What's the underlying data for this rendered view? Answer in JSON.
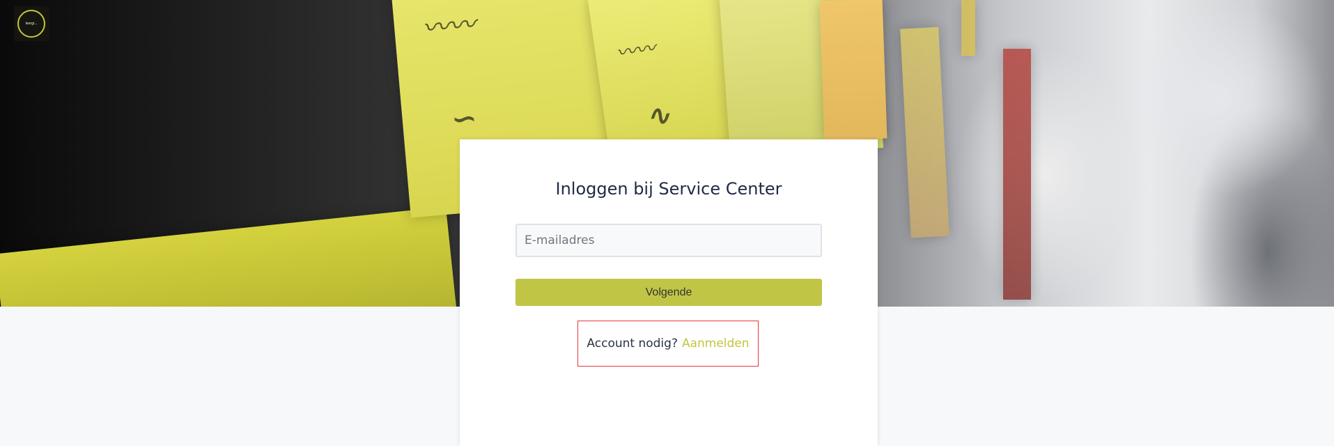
{
  "header": {
    "logo_text": "leergi..."
  },
  "login": {
    "title": "Inloggen bij Service Center",
    "email_placeholder": "E-mailadres",
    "email_value": "",
    "next_label": "Volgende",
    "signup_prompt": "Account nodig?",
    "signup_link": "Aanmelden"
  },
  "colors": {
    "accent": "#c1c545",
    "link": "#c3c43c",
    "title": "#1f2a44",
    "highlight_border": "#e23a3a",
    "page_background": "#f7f8fa"
  }
}
